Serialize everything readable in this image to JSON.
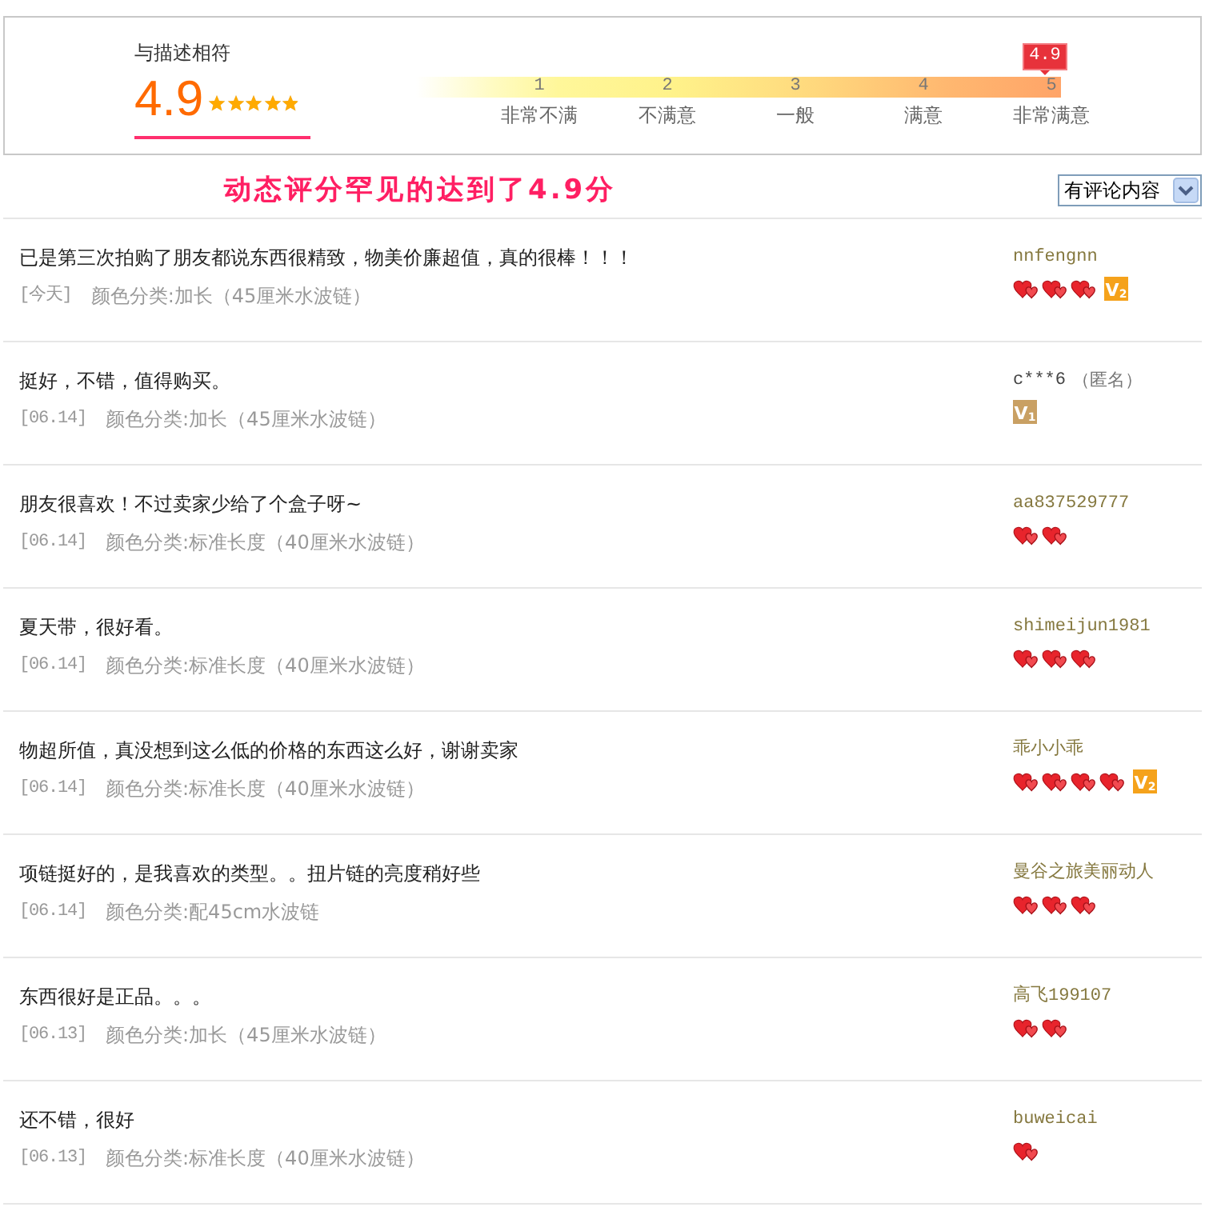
{
  "rating": {
    "label": "与描述相符",
    "score": "4.9",
    "stars": 4.9,
    "scale": {
      "ticks": [
        {
          "label": "1",
          "selected": false
        },
        {
          "label": "2",
          "selected": false
        },
        {
          "label": "3",
          "selected": false
        },
        {
          "label": "4",
          "selected": false
        },
        {
          "label": "5",
          "selected": true
        }
      ],
      "labels": [
        "非常不满",
        "不满意",
        "一般",
        "满意",
        "非常满意"
      ],
      "marker": {
        "label": "4.9"
      }
    }
  },
  "headline": "动态评分罕见的达到了4.9分",
  "filter": {
    "value": "有评论内容"
  },
  "reviews": [
    {
      "text": "已是第三次拍购了朋友都说东西很精致，物美价廉超值，真的很棒！！！",
      "date": "[今天]",
      "variant": "颜色分类:加长（45厘米水波链）",
      "user": "nnfengnn",
      "anonymous": false,
      "credit_icons": [
        {
          "kind": "heart"
        },
        {
          "kind": "heart"
        },
        {
          "kind": "heart"
        }
      ],
      "badge": {
        "text": "V$_{2}$",
        "color": "#f5a21b"
      }
    },
    {
      "text": "挺好，不错，值得购买。",
      "date": "[06.14]",
      "variant": "颜色分类:加长（45厘米水波链）",
      "user": "c***6",
      "anonymous": true,
      "note": "（匿名）",
      "badge": {
        "text": "V$_{1}$",
        "color": "#c9a063"
      }
    },
    {
      "text": "朋友很喜欢！不过卖家少给了个盒子呀~",
      "date": "[06.14]",
      "variant": "颜色分类:标准长度（40厘米水波链）",
      "user": "aa837529777",
      "anonymous": false,
      "credit_icons": [
        {
          "kind": "heart"
        },
        {
          "kind": "heart"
        }
      ]
    },
    {
      "text": "夏天带，很好看。",
      "date": "[06.14]",
      "variant": "颜色分类:标准长度（40厘米水波链）",
      "user": "shimeijun1981",
      "anonymous": false,
      "credit_icons": [
        {
          "kind": "heart"
        },
        {
          "kind": "heart"
        },
        {
          "kind": "heart"
        }
      ]
    },
    {
      "text": "物超所值，真没想到这么低的价格的东西这么好，谢谢卖家",
      "date": "[06.14]",
      "variant": "颜色分类:标准长度（40厘米水波链）",
      "user": "乖小小乖",
      "anonymous": false,
      "credit_icons": [
        {
          "kind": "heart"
        },
        {
          "kind": "heart"
        },
        {
          "kind": "heart"
        },
        {
          "kind": "heart"
        }
      ],
      "badge": {
        "text": "V$_{2}$",
        "color": "#f5a21b"
      }
    },
    {
      "text": "项链挺好的，是我喜欢的类型。。扭片链的亮度稍好些",
      "date": "[06.14]",
      "variant": "颜色分类:配45cm水波链",
      "user": "曼谷之旅美丽动人",
      "anonymous": false,
      "credit_icons": [
        {
          "kind": "heart"
        },
        {
          "kind": "heart"
        },
        {
          "kind": "heart"
        }
      ]
    },
    {
      "text": "东西很好是正品。。。",
      "date": "[06.13]",
      "variant": "颜色分类:加长（45厘米水波链）",
      "user": "高飞199107",
      "anonymous": false,
      "credit_icons": [
        {
          "kind": "heart"
        },
        {
          "kind": "heart"
        }
      ]
    },
    {
      "text": "还不错，很好",
      "date": "[06.13]",
      "variant": "颜色分类:标准长度（40厘米水波链）",
      "user": "buweicai",
      "anonymous": false,
      "credit_icons": [
        {
          "kind": "heart"
        }
      ]
    }
  ]
}
